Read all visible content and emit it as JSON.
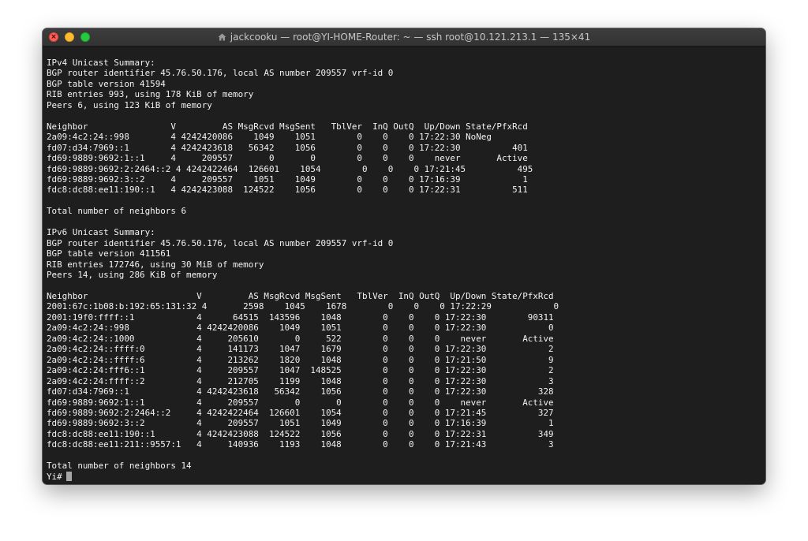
{
  "window": {
    "title": "jackcooku — root@YI-HOME-Router: ~ — ssh root@10.121.213.1 — 135×41"
  },
  "terminal": {
    "output": "IPv4 Unicast Summary:\nBGP router identifier 45.76.50.176, local AS number 209557 vrf-id 0\nBGP table version 41594\nRIB entries 993, using 178 KiB of memory\nPeers 6, using 123 KiB of memory\n\nNeighbor                V         AS MsgRcvd MsgSent   TblVer  InQ OutQ  Up/Down State/PfxRcd\n2a09:4c2:24::998        4 4242420086    1049    1051        0    0    0 17:22:30 NoNeg\nfd07:d34:7969::1        4 4242423618   56342    1056        0    0    0 17:22:30          401\nfd69:9889:9692:1::1     4     209557       0       0        0    0    0    never       Active\nfd69:9889:9692:2:2464::2 4 4242422464  126601    1054        0    0    0 17:21:45          495\nfd69:9889:9692:3::2     4     209557    1051    1049        0    0    0 17:16:39            1\nfdc8:dc88:ee11:190::1   4 4242423088  124522    1056        0    0    0 17:22:31          511\n\nTotal number of neighbors 6\n\nIPv6 Unicast Summary:\nBGP router identifier 45.76.50.176, local AS number 209557 vrf-id 0\nBGP table version 411561\nRIB entries 172746, using 30 MiB of memory\nPeers 14, using 286 KiB of memory\n\nNeighbor                     V         AS MsgRcvd MsgSent   TblVer  InQ OutQ  Up/Down State/PfxRcd\n2001:67c:1b08:b:192:65:131:32 4       2598    1045    1678        0    0    0 17:22:29            0\n2001:19f0:ffff::1            4      64515  143596    1048        0    0    0 17:22:30        90311\n2a09:4c2:24::998             4 4242420086    1049    1051        0    0    0 17:22:30            0\n2a09:4c2:24::1000            4     205610       0     522        0    0    0    never       Active\n2a09:4c2:24::ffff:0          4     141173    1047    1679        0    0    0 17:22:30            2\n2a09:4c2:24::ffff:6          4     213262    1820    1048        0    0    0 17:21:50            9\n2a09:4c2:24:fff6::1          4     209557    1047  148525        0    0    0 17:22:30            2\n2a09:4c2:24:ffff::2          4     212705    1199    1048        0    0    0 17:22:30            3\nfd07:d34:7969::1             4 4242423618   56342    1056        0    0    0 17:22:30          328\nfd69:9889:9692:1::1          4     209557       0       0        0    0    0    never       Active\nfd69:9889:9692:2:2464::2     4 4242422464  126601    1054        0    0    0 17:21:45          327\nfd69:9889:9692:3::2          4     209557    1051    1049        0    0    0 17:16:39            1\nfdc8:dc88:ee11:190::1        4 4242423088  124522    1056        0    0    0 17:22:31          349\nfdc8:dc88:ee11:211::9557:1   4     140936    1193    1048        0    0    0 17:21:43            3\n\nTotal number of neighbors 14",
    "prompt": "Yi#"
  },
  "icons": [
    "close-icon",
    "minimize-icon",
    "maximize-icon",
    "home-folder-icon",
    "terminal-cursor"
  ],
  "colors": {
    "background": "#1e1e1e",
    "text": "#f2f2f2",
    "titlebar": "#383838",
    "close": "#fe5f57",
    "minimize": "#febc2e",
    "maximize": "#28c840",
    "cursor": "#a6a6a6"
  }
}
